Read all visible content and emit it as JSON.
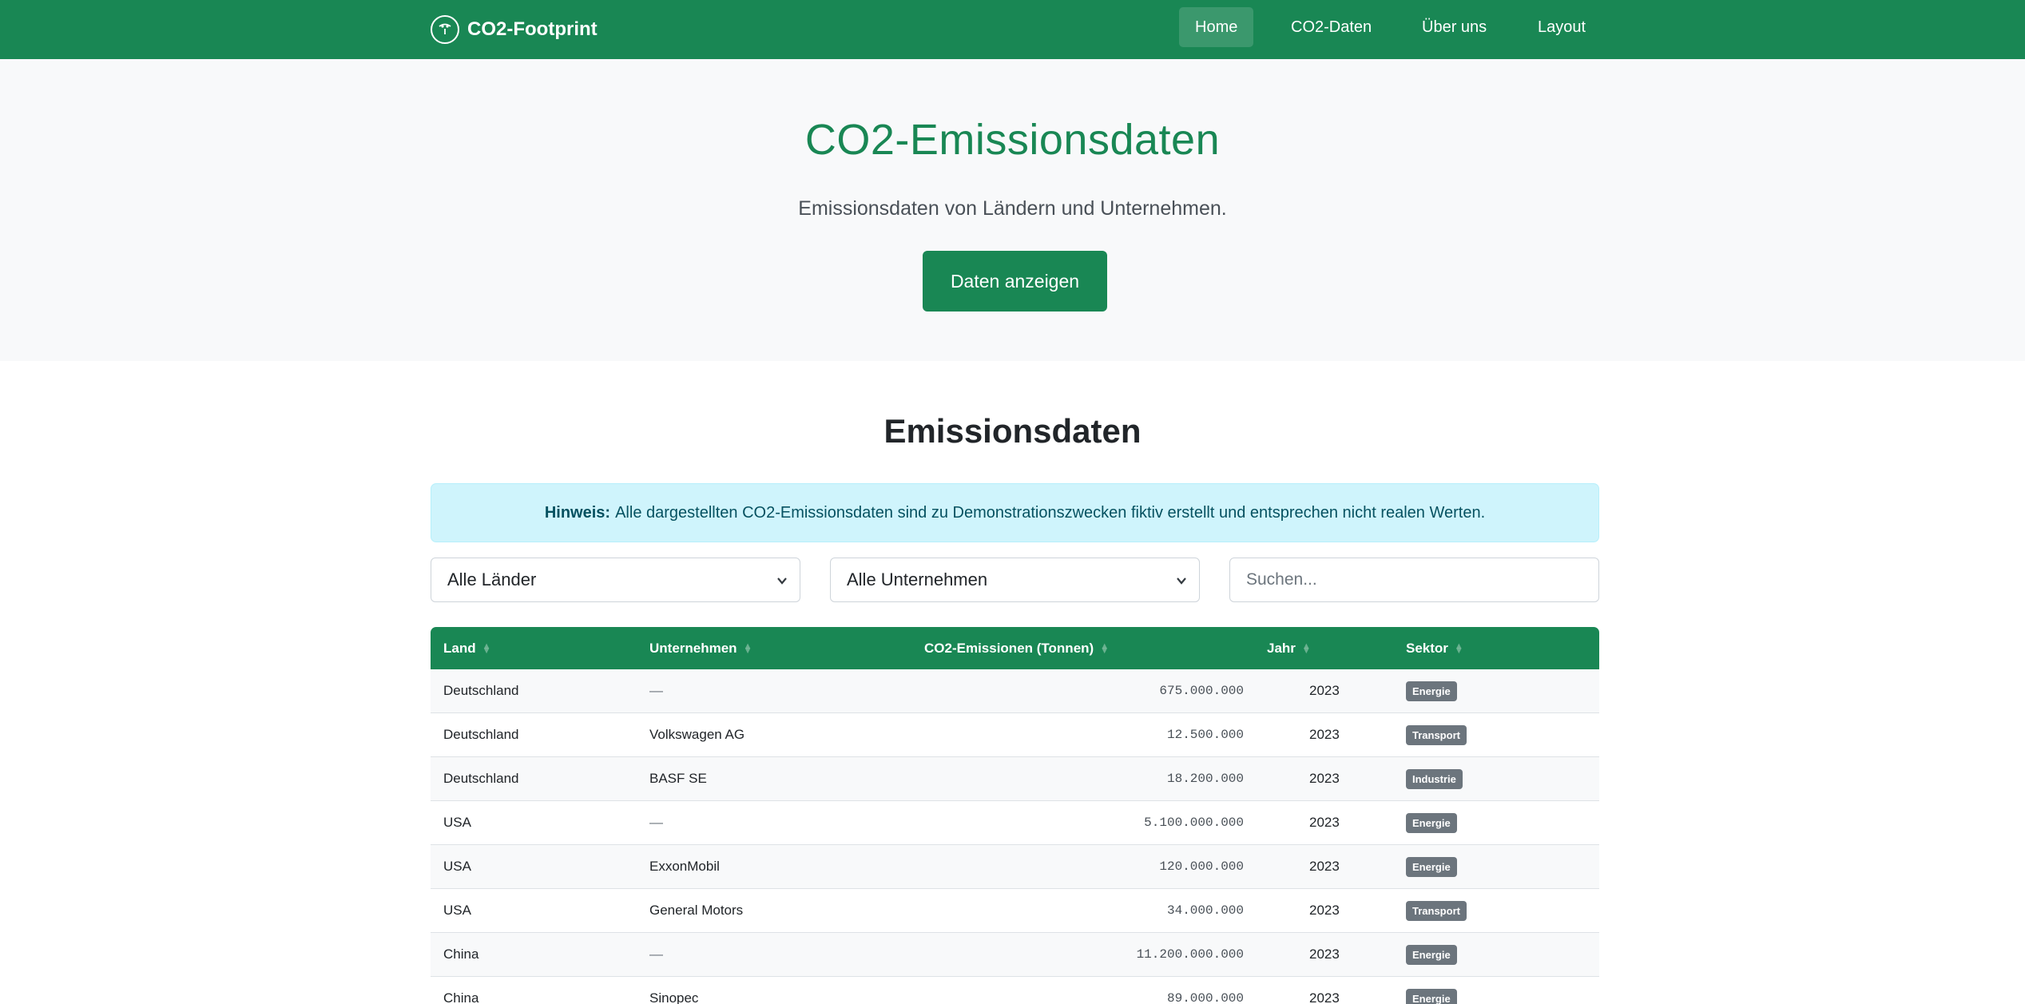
{
  "nav": {
    "brand": "CO2-Footprint",
    "links": [
      "Home",
      "CO2-Daten",
      "Über uns",
      "Layout"
    ]
  },
  "hero": {
    "title": "CO2-Emissionsdaten",
    "lead": "Emissionsdaten von Ländern und Unternehmen.",
    "button": "Daten anzeigen"
  },
  "section": {
    "title": "Emissionsdaten"
  },
  "alert": {
    "strong": "Hinweis:",
    "text": "Alle dargestellten CO2-Emissionsdaten sind zu Demonstrationszwecken fiktiv erstellt und entsprechen nicht realen Werten."
  },
  "filters": {
    "country": "Alle Länder",
    "company": "Alle Unternehmen",
    "search_placeholder": "Suchen..."
  },
  "table": {
    "headers": [
      "Land",
      "Unternehmen",
      "CO2-Emissionen (Tonnen)",
      "Jahr",
      "Sektor"
    ],
    "rows": [
      {
        "land": "Deutschland",
        "unternehmen": "—",
        "emissionen": "675.000.000",
        "jahr": "2023",
        "sektor": "Energie"
      },
      {
        "land": "Deutschland",
        "unternehmen": "Volkswagen AG",
        "emissionen": "12.500.000",
        "jahr": "2023",
        "sektor": "Transport"
      },
      {
        "land": "Deutschland",
        "unternehmen": "BASF SE",
        "emissionen": "18.200.000",
        "jahr": "2023",
        "sektor": "Industrie"
      },
      {
        "land": "USA",
        "unternehmen": "—",
        "emissionen": "5.100.000.000",
        "jahr": "2023",
        "sektor": "Energie"
      },
      {
        "land": "USA",
        "unternehmen": "ExxonMobil",
        "emissionen": "120.000.000",
        "jahr": "2023",
        "sektor": "Energie"
      },
      {
        "land": "USA",
        "unternehmen": "General Motors",
        "emissionen": "34.000.000",
        "jahr": "2023",
        "sektor": "Transport"
      },
      {
        "land": "China",
        "unternehmen": "—",
        "emissionen": "11.200.000.000",
        "jahr": "2023",
        "sektor": "Energie"
      },
      {
        "land": "China",
        "unternehmen": "Sinopec",
        "emissionen": "89.000.000",
        "jahr": "2023",
        "sektor": "Energie"
      }
    ]
  },
  "colors": {
    "primary": "#198754",
    "hero_bg": "#f8f9fa",
    "alert_bg": "#cff4fc",
    "badge": "#6c757d"
  }
}
